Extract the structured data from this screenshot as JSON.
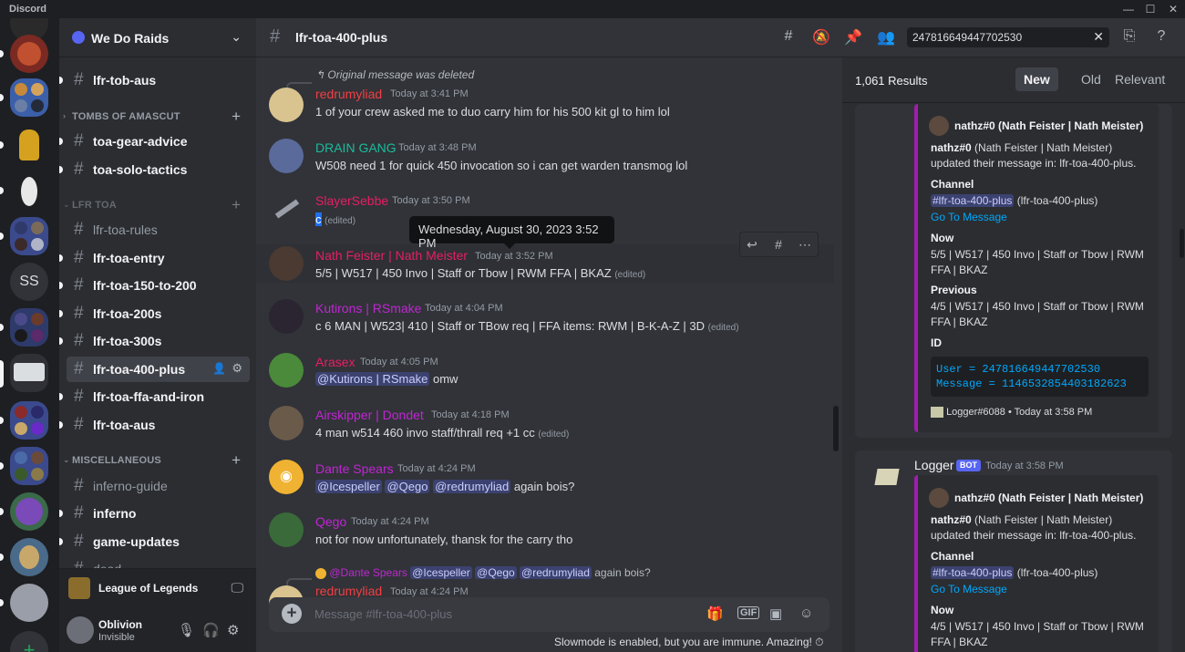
{
  "window": {
    "app_name": "Discord",
    "minimize": "—",
    "maximize": "☐",
    "close": "✕"
  },
  "guild_dm_initials": "SS",
  "server": {
    "name": "We Do Raids"
  },
  "sidebar": {
    "channels_top": [
      {
        "label": "lfr-tob-aus"
      }
    ],
    "categories": [
      {
        "label": "TOMBS OF AMASCUT",
        "channels": [
          {
            "label": "toa-gear-advice"
          },
          {
            "label": "toa-solo-tactics"
          }
        ]
      },
      {
        "label": "LFR TOA",
        "channels": [
          {
            "label": "lfr-toa-rules"
          },
          {
            "label": "lfr-toa-entry"
          },
          {
            "label": "lfr-toa-150-to-200"
          },
          {
            "label": "lfr-toa-200s"
          },
          {
            "label": "lfr-toa-300s"
          },
          {
            "label": "lfr-toa-400-plus"
          },
          {
            "label": "lfr-toa-ffa-and-iron"
          },
          {
            "label": "lfr-toa-aus"
          }
        ]
      },
      {
        "label": "MISCELLANEOUS",
        "channels": [
          {
            "label": "inferno-guide"
          },
          {
            "label": "inferno"
          },
          {
            "label": "game-updates"
          },
          {
            "label": "dead"
          }
        ]
      }
    ],
    "activity": {
      "label": "League of Legends"
    },
    "user": {
      "name": "Oblivion",
      "status": "Invisible"
    }
  },
  "channel": {
    "name": "lfr-toa-400-plus"
  },
  "search": {
    "value": "247816649447702530"
  },
  "messages": [
    {
      "reply": "Original message was deleted",
      "author": "redrumyliad",
      "time": "Today at 3:41 PM",
      "content": "1 of your crew asked me to duo carry him for his 500 kit gl to him lol",
      "color": "#f23f43"
    },
    {
      "author": "DRAIN GANG",
      "time": "Today at 3:48 PM",
      "content": "W508 need 1 for quick 450 invocation so i can get warden transmog lol",
      "color": "#1abc9c"
    },
    {
      "author": "SlayerSebbe",
      "time": "Today at 3:50 PM",
      "content": "c",
      "edited": "(edited)",
      "color": "#e91e63"
    },
    {
      "author": "Nath Feister | Nath Meister",
      "time": "Today at 3:52 PM",
      "content": "5/5 | W517 | 450 Invo | Staff or Tbow | RWM FFA | BKAZ",
      "edited": "(edited)",
      "color": "#e91e63"
    },
    {
      "author": "Kutirons | RSmake",
      "time": "Today at 4:04 PM",
      "content": "c 6 MAN | W523| 410 | Staff or TBow req | FFA items: RWM | B-K-A-Z | 3D",
      "edited": "(edited)",
      "color": "#c026d3"
    },
    {
      "author": "Arasex",
      "time": "Today at 4:05 PM",
      "mention": "@Kutirons | RSmake",
      "content": "omw",
      "color": "#e91e63"
    },
    {
      "author": "Airskipper | Dondet",
      "time": "Today at 4:18 PM",
      "content": "4 man w514 460 invo staff/thrall req +1 cc",
      "edited": "(edited)",
      "color": "#c026d3"
    },
    {
      "author": "Dante Spears",
      "time": "Today at 4:24 PM",
      "mentions": [
        "@Icespeller",
        "@Qego",
        "@redrumyliad"
      ],
      "content": "again bois?",
      "color": "#c026d3"
    },
    {
      "author": "Qego",
      "time": "Today at 4:24 PM",
      "content": "not for now unfortunately, thansk for the carry tho",
      "color": "#c026d3"
    },
    {
      "reply": "@Dante Spears",
      "reply_mentions": [
        "@Icespeller",
        "@Qego",
        "@redrumyliad"
      ],
      "reply_tail": "again bois?",
      "author": "redrumyliad",
      "time": "Today at 4:24 PM",
      "color": "#f23f43"
    }
  ],
  "tooltip": "Wednesday, August 30, 2023 3:52 PM",
  "composer": {
    "placeholder": "Message #lfr-toa-400-plus",
    "gif": "GIF"
  },
  "slowmode": "Slowmode is enabled, but you are immune. Amazing!",
  "results": {
    "count": "1,061 Results",
    "sort": [
      "New",
      "Old",
      "Relevant"
    ],
    "card1": {
      "embed_author": "nathz#0 (Nath Feister | Nath Meister)",
      "desc_user": "nathz#0",
      "desc_rest": "(Nath Feister | Nath Meister) updated their message in: lfr-toa-400-plus.",
      "channel_label": "Channel",
      "channel_mention": "#lfr-toa-400-plus",
      "channel_paren": "(lfr-toa-400-plus)",
      "goto": "Go To Message",
      "now_label": "Now",
      "now": "5/5 | W517 | 450 Invo | Staff or Tbow | RWM FFA | BKAZ",
      "prev_label": "Previous",
      "prev": "4/5 | W517 | 450 Invo | Staff or Tbow | RWM FFA | BKAZ",
      "id_label": "ID",
      "code_user": "User = 247816649447702530",
      "code_msg": "Message = 1146532854403182623",
      "footer": "Logger#6088 • Today at 3:58 PM"
    },
    "card2": {
      "bot_name": "Logger",
      "bot_badge": "BOT",
      "bot_time": "Today at 3:58 PM",
      "embed_author": "nathz#0 (Nath Feister | Nath Meister)",
      "desc_user": "nathz#0",
      "desc_rest": "(Nath Feister | Nath Meister) updated their message in: lfr-toa-400-plus.",
      "channel_label": "Channel",
      "channel_mention": "#lfr-toa-400-plus",
      "channel_paren": "(lfr-toa-400-plus)",
      "goto": "Go To Message",
      "now_label": "Now",
      "now": "4/5 | W517 | 450 Invo | Staff or Tbow | RWM FFA | BKAZ"
    }
  },
  "colors": {
    "accent": "#5865f2",
    "background": "#313338",
    "sidebar": "#2b2d31",
    "embed_border": "#a21caf",
    "link": "#00a8fc"
  }
}
